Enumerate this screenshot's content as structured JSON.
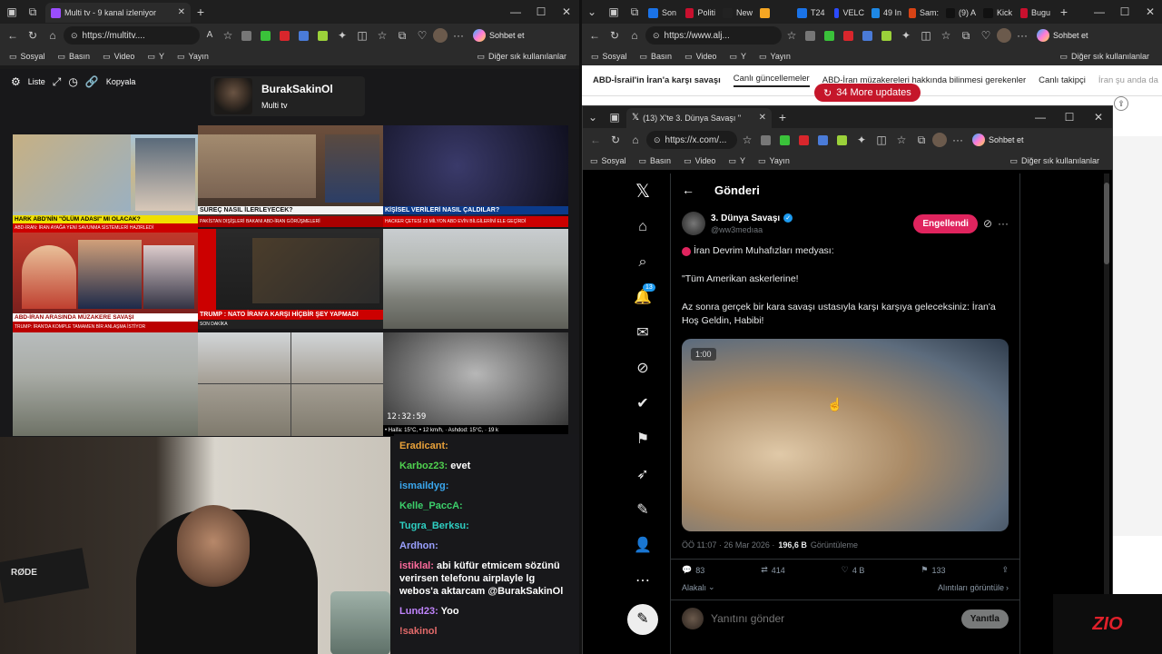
{
  "left_browser": {
    "tab_title": "Multi tv - 9 kanal izleniyor",
    "url": "https://multitv....",
    "copilot_label": "Sohbet et",
    "bookmarks": [
      "Sosyal",
      "Basın",
      "Video",
      "Y",
      "Yayın"
    ],
    "other_bookmarks": "Diğer sık kullanılanlar"
  },
  "multitv": {
    "toolbar": {
      "list_label": "Liste",
      "copy_label": "Kopyala"
    },
    "channel_name": "BurakSakinOl",
    "channel_sub": "Multi tv",
    "tiles": [
      {
        "caption": "HARK ABD'NİN \"ÖLÜM ADASI\" MI OLACAK?",
        "ticker": "ABD-İRAN: İRAN AYAĞA YENİ SAVUNMA SİSTEMLERİ HAZIRLEDİ"
      },
      {
        "caption": "SÜREÇ NASIL İLERLEYECEK?",
        "ticker": "PAKİSTAN DIŞİŞLERİ BAKANI ABD-İRAN GÖRÜŞMELERİ"
      },
      {
        "caption": "KİŞİSEL VERİLERİ NASIL ÇALDILAR?",
        "ticker": "HACKER ÇETESİ 10 MİLYON ABD EVİN BİLGİLERİNİ ELE GEÇİRDİ"
      },
      {
        "caption": "ABD-İRAN ARASINDA MÜZAKERE SAVAŞI",
        "ticker": "TRUMP: İRAN'DA KOMPLE TAMAMEN BİR ANLAŞMA İSTİYOR"
      },
      {
        "caption": "TRUMP : NATO İRAN'A KARŞI HİÇBİR ŞEY YAPMADI",
        "ticker": "SON DAKİKA"
      },
      {
        "caption": "",
        "ticker": ""
      },
      {
        "caption": "",
        "ticker": ""
      },
      {
        "caption": "",
        "ticker": ""
      },
      {
        "caption": "12:32:59",
        "ticker": "• Haifa: 15°C, • 12 km/h, · Ashdod: 15°C, · 19 k"
      }
    ]
  },
  "chat": {
    "messages": [
      {
        "user": "Eradicant:",
        "text": "",
        "color": "#e8a13a"
      },
      {
        "user": "Karboz23:",
        "text": "evet",
        "color": "#4fd04f"
      },
      {
        "user": "ismaildyg:",
        "text": "",
        "color": "#3aa8f0"
      },
      {
        "user": "Kelle_PaccA:",
        "text": "",
        "color": "#3ccf6b"
      },
      {
        "user": "Tugra_Berksu:",
        "text": "",
        "color": "#2ecfc2"
      },
      {
        "user": "Ardhon:",
        "text": "",
        "color": "#9aa0ff"
      },
      {
        "user": "istiklal:",
        "text": "abi küfür etmicem sözünü verirsen telefonu airplayle lg webos'a aktarcam @BurakSakinOl",
        "color": "#ff6b9d"
      },
      {
        "user": "Lund23:",
        "text": "Yoo",
        "color": "#c084fc"
      },
      {
        "user": "",
        "text": "!sakinol",
        "color": "#e36a6a"
      }
    ]
  },
  "right_browser": {
    "tab_labels": [
      "Son",
      "Politi",
      "New",
      "",
      "T24",
      "VELC",
      "49 In",
      "Sam:",
      "(9) A",
      "Kick",
      "Bugu"
    ],
    "url": "https://www.alj...",
    "copilot_label": "Sohbet et",
    "bookmarks": [
      "Sosyal",
      "Basın",
      "Video",
      "Y",
      "Yayın"
    ],
    "other_bookmarks": "Diğer sık kullanılanlar",
    "nav_items": [
      "ABD-İsrail'in İran'a karşı savaşı",
      "Canlı güncellemeler",
      "ABD-İran müzakereleri hakkında bilinmesi gerekenler",
      "Canlı takipçi",
      "İran şu anda da"
    ],
    "updates_badge": "34 More updates"
  },
  "x_window": {
    "tab_title": "(13) X'te 3. Dünya Savaşı \"",
    "url": "https://x.com/...",
    "copilot_label": "Sohbet et",
    "bookmarks": [
      "Sosyal",
      "Basın",
      "Video",
      "Y",
      "Yayın"
    ],
    "other_bookmarks": "Diğer sık kullanılanlar",
    "header_title": "Gönderi",
    "notification_count": "13",
    "author_name": "3. Dünya Savaşı",
    "author_handle": "@ww3medıaa",
    "follow_button": "Engellendi",
    "tweet_line1": "İran Devrim Muhafızları medyası:",
    "tweet_line2": "\"Tüm Amerikan askerlerine!",
    "tweet_line3": "Az sonra gerçek bir kara savaşı ustasıyla karşı karşıya geleceksiniz: İran'a Hoş Geldin, Habibi!",
    "video_time": "1:00",
    "timestamp": "ÖÖ 11:07 · 26 Mar 2026 ·",
    "views_count": "196,6 B",
    "views_label": "Görüntüleme",
    "replies": "83",
    "reposts": "414",
    "likes": "4 B",
    "bookmarks_count": "133",
    "sort_label": "Alakalı",
    "quotes_link": "Alıntıları görüntüle",
    "reply_placeholder": "Yanıtını gönder",
    "reply_button": "Yanıtla"
  },
  "overlay": {
    "brand": "ZIO",
    "mic_brand": "RØDE"
  },
  "colors": {
    "x_red": "#e0245e",
    "accent_blue": "#1d9bf0"
  }
}
